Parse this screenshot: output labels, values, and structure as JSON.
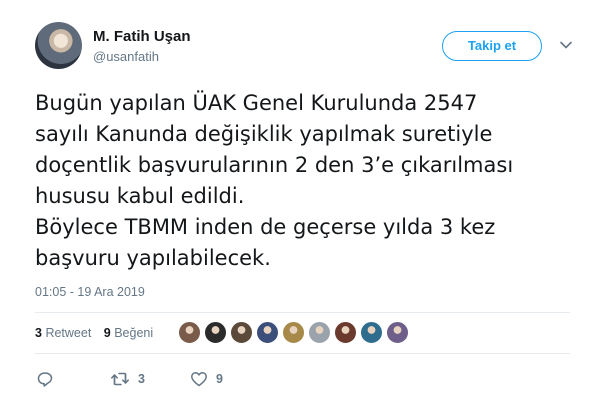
{
  "author": {
    "name": "M. Fatih Uşan",
    "handle": "@usanfatih"
  },
  "follow_label": "Takip et",
  "tweet": {
    "lines": [
      "Bugün yapılan ÜAK Genel Kurulunda 2547",
      "sayılı Kanunda değişiklik yapılmak suretiyle",
      "doçentlik başvurularının 2 den 3’e çıkarılması",
      "hususu kabul edildi.",
      "Böylece TBMM inden de geçerse yılda 3 kez",
      "başvuru yapılabilecek."
    ]
  },
  "timestamp": "01:05 - 19 Ara 2019",
  "stats": {
    "retweet_count": "3",
    "retweet_label": "Retweet",
    "like_count": "9",
    "like_label": "Beğeni"
  },
  "likers": [
    {
      "color": "#7a5a48"
    },
    {
      "color": "#2b2b2b"
    },
    {
      "color": "#5b4a3a"
    },
    {
      "color": "#3b4f7a"
    },
    {
      "color": "#a78a4a"
    },
    {
      "color": "#9aa3ab"
    },
    {
      "color": "#6b3a2e"
    },
    {
      "color": "#2f6d8f"
    },
    {
      "color": "#6e5f8a"
    }
  ],
  "actions": {
    "reply_count": "",
    "retweet_count": "3",
    "like_count": "9"
  },
  "colors": {
    "accent": "#1da1f2",
    "secondary_text": "#657786",
    "divider": "#e6ecf0"
  },
  "icons": [
    "caret-down-icon",
    "reply-icon",
    "retweet-icon",
    "heart-icon"
  ]
}
